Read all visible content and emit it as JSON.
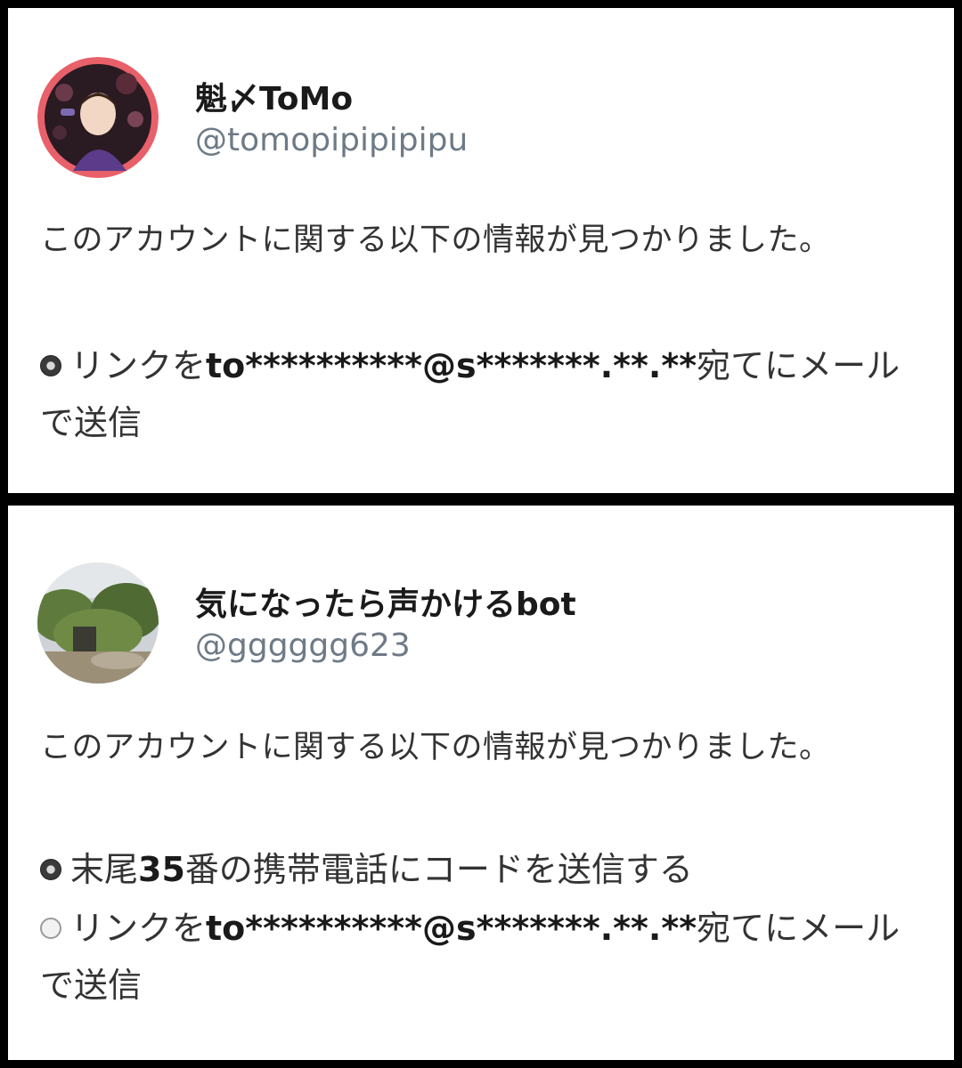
{
  "panels": [
    {
      "display_name": "魁〆ToMo",
      "handle": "@tomopipipipipu",
      "intro": "このアカウントに関する以下の情報が見つかりました。",
      "options": [
        {
          "selected": true,
          "prefix": "リンクを",
          "masked": "to**********@s*******.**.**",
          "suffix": "宛てにメールで送信"
        }
      ]
    },
    {
      "display_name": "気になったら声かけるbot",
      "handle": "@gggggg623",
      "intro": "このアカウントに関する以下の情報が見つかりました。",
      "options": [
        {
          "selected": true,
          "prefix": "末尾",
          "masked": "35",
          "suffix": "番の携帯電話にコードを送信する"
        },
        {
          "selected": false,
          "prefix": "リンクを",
          "masked": "to**********@s*******.**.**",
          "suffix": "宛てにメールで送信"
        }
      ]
    }
  ]
}
